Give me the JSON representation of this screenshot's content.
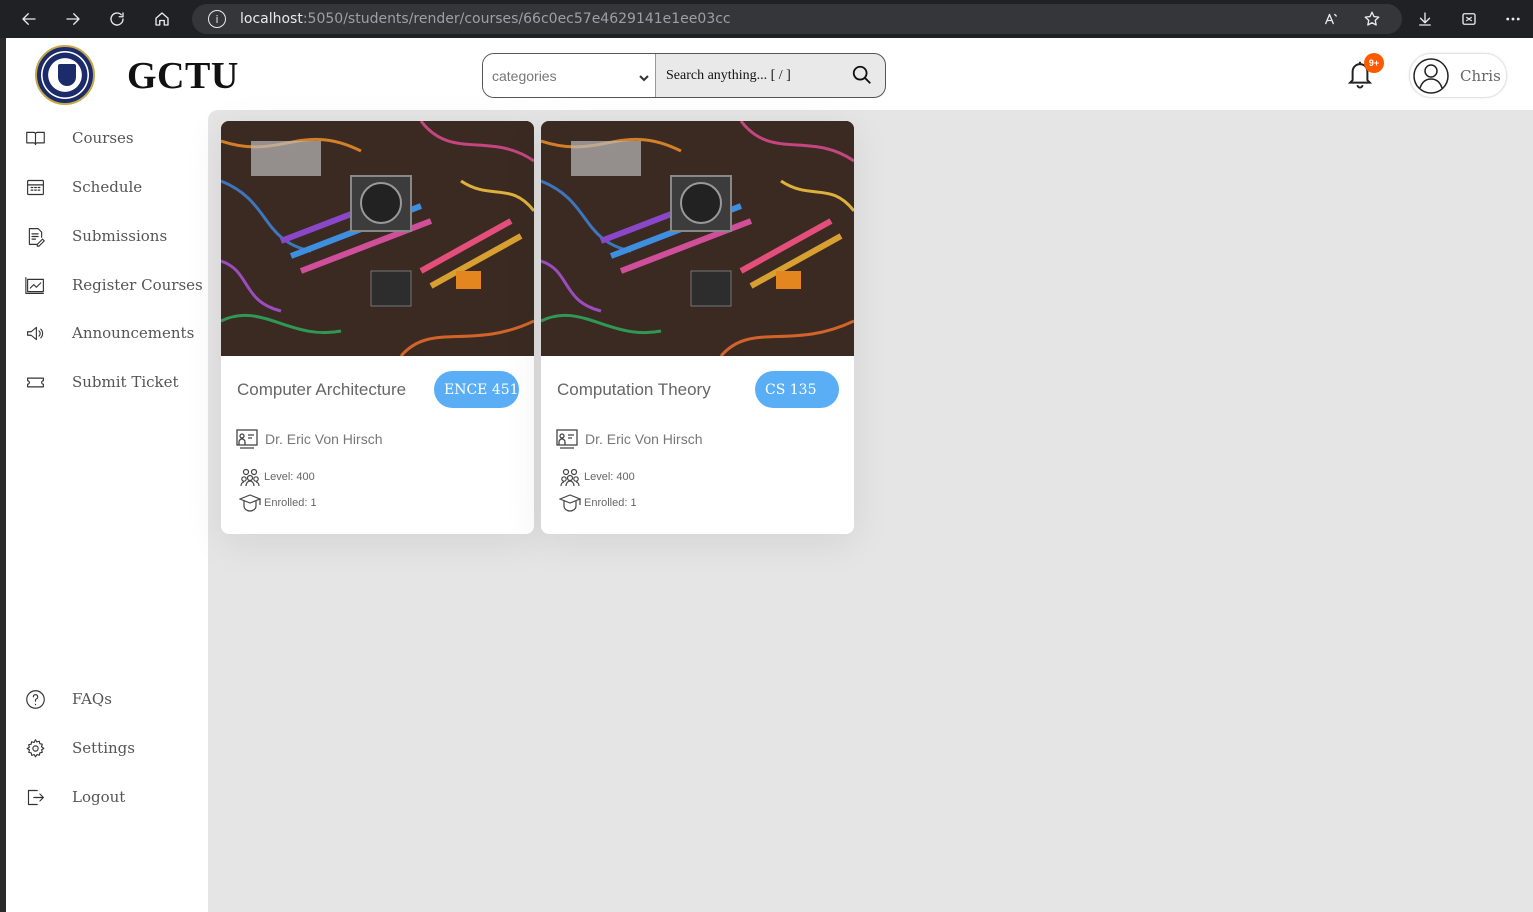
{
  "browser": {
    "url_host": "localhost",
    "url_path": ":5050/students/render/courses/66c0ec57e4629141e1ee03cc",
    "nav_icons": [
      "back-icon",
      "forward-icon",
      "reload-icon",
      "home-icon"
    ],
    "right_icons": [
      "read-aloud-icon",
      "favorite-star-icon",
      "download-icon",
      "extensions-icon",
      "more-icon"
    ]
  },
  "header": {
    "brand": "GCTU",
    "search": {
      "category_placeholder": "categories",
      "query_placeholder": "Search anything... [ / ]"
    },
    "notifications_badge": "9+",
    "user_name": "Chris"
  },
  "sidebar": {
    "items": [
      {
        "label": "Courses",
        "icon": "book-icon"
      },
      {
        "label": "Schedule",
        "icon": "calendar-icon"
      },
      {
        "label": "Submissions",
        "icon": "document-edit-icon"
      },
      {
        "label": "Register Courses",
        "icon": "register-icon"
      },
      {
        "label": "Announcements",
        "icon": "megaphone-icon"
      },
      {
        "label": "Submit Ticket",
        "icon": "ticket-icon"
      }
    ],
    "bottom_items": [
      {
        "label": "FAQs",
        "icon": "question-icon"
      },
      {
        "label": "Settings",
        "icon": "gear-icon"
      },
      {
        "label": "Logout",
        "icon": "logout-icon"
      }
    ]
  },
  "courses": [
    {
      "title": "Computer Architecture",
      "code": "ENCE 451",
      "lecturer": "Dr. Eric Von Hirsch",
      "level": "Level: 400",
      "enrolled": "Enrolled: 1"
    },
    {
      "title": "Computation Theory",
      "code": "CS 135",
      "lecturer": "Dr. Eric Von Hirsch",
      "level": "Level: 400",
      "enrolled": "Enrolled: 1"
    }
  ],
  "colors": {
    "accent_pill": "#5aaef5",
    "badge": "#ff5a00",
    "main_bg": "#e5e5e5"
  }
}
